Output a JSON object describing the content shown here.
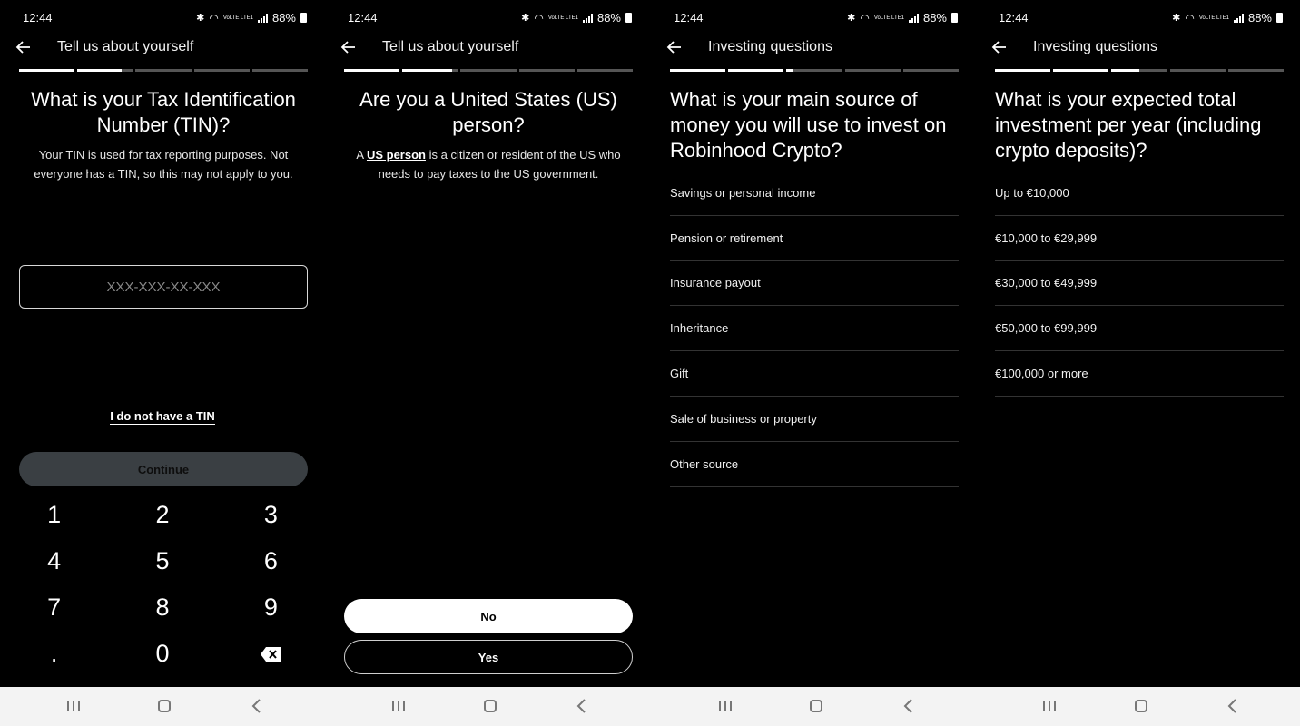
{
  "status": {
    "time": "12:44",
    "battery": "88%",
    "network": "VoLTE LTE1"
  },
  "screens": [
    {
      "title": "Tell us about yourself",
      "progress": [
        1,
        0.8,
        0,
        0,
        0
      ],
      "heading": "What is your Tax Identification Number (TIN)?",
      "description": "Your TIN is used for tax reporting purposes. Not everyone has a TIN, so this may not apply to you.",
      "tin_placeholder": "XXX-XXX-XX-XXX",
      "no_tin_link": "I do not have a TIN",
      "continue_label": "Continue",
      "keys": [
        "1",
        "2",
        "3",
        "4",
        "5",
        "6",
        "7",
        "8",
        "9",
        ".",
        "0",
        "backspace-icon"
      ]
    },
    {
      "title": "Tell us about yourself",
      "progress": [
        1,
        0.9,
        0,
        0,
        0
      ],
      "heading": "Are you a United States (US) person?",
      "desc_prefix": "A ",
      "desc_link": "US person",
      "desc_suffix": " is a citizen or resident of the US who needs to pay taxes to the US government.",
      "no_label": "No",
      "yes_label": "Yes"
    },
    {
      "title": "Investing questions",
      "progress": [
        1,
        1,
        0.1,
        0,
        0
      ],
      "heading": "What is your main source of money you will use to invest on Robinhood Crypto?",
      "options": [
        "Savings or personal income",
        "Pension or retirement",
        "Insurance payout",
        "Inheritance",
        "Gift",
        "Sale of business or property",
        "Other source"
      ]
    },
    {
      "title": "Investing questions",
      "progress": [
        1,
        1,
        0.5,
        0,
        0
      ],
      "heading": "What is your expected total investment per year (including crypto deposits)?",
      "options": [
        "Up to €10,000",
        "€10,000 to €29,999",
        "€30,000 to €49,999",
        "€50,000 to €99,999",
        "€100,000 or more"
      ]
    }
  ],
  "navbar": {
    "icons": [
      "recent-apps-icon",
      "home-icon",
      "back-icon"
    ]
  },
  "colors": {
    "background": "#000000",
    "continue_disabled": "#3a3f43",
    "divider": "#333333",
    "navbar": "#f3f3f3"
  }
}
